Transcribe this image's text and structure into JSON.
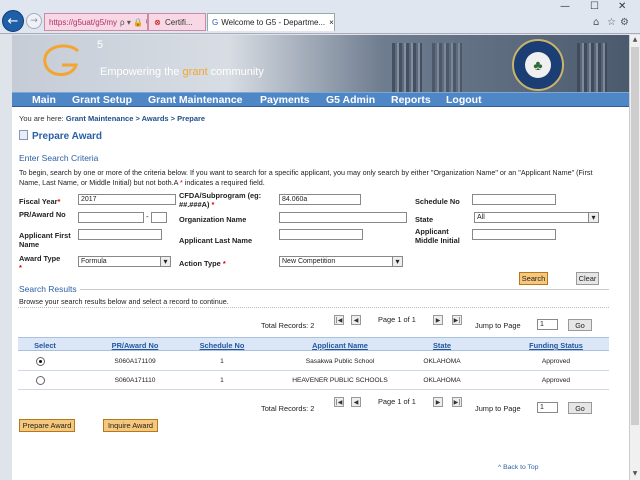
{
  "browser": {
    "address": "https://g5uat/g5/my",
    "address_icons": "ρ ▾ 🔒 ↻",
    "cert_tab": "Certifi...",
    "active_tab": "Welcome to G5 - Departme...",
    "tab_close": "×",
    "controls": {
      "minimize": "—",
      "maximize": "☐",
      "close": "✕"
    },
    "tools": {
      "home": "⌂",
      "favorites": "☆",
      "settings": "⚙"
    }
  },
  "banner": {
    "logo_text": "G",
    "logo_super": "5",
    "tagline_pre": "Empowering the ",
    "tagline_accent": "grant",
    "tagline_post": " community",
    "seal_icon": "tree-icon"
  },
  "menu": [
    "Main",
    "Grant Setup",
    "Grant Maintenance",
    "Payments",
    "G5 Admin",
    "Reports",
    "Logout"
  ],
  "breadcrumb": {
    "prefix": "You are here:",
    "path": "Grant Maintenance > Awards > Prepare"
  },
  "page_title": "Prepare Award",
  "search": {
    "heading": "Enter Search Criteria",
    "intro": "To begin, search by one or more of the criteria below. If you want to search for a specific applicant, you may only search by either \"Organization Name\" or an \"Applicant Name\" (First Name, Last Name, or Middle Initial) but not both.A ",
    "intro_star": "*",
    "intro_end": " indicates a required field.",
    "fiscal_year_label": "Fiscal Year",
    "fiscal_year_value": "2017",
    "cfda_label": "CFDA/Subprogram (eg: ##.###A)",
    "cfda_value": "84.060a",
    "schedule_label": "Schedule No",
    "schedule_value": "",
    "pr_award_label": "PR/Award No",
    "pr_award_value": "",
    "pr_award_suffix": "",
    "org_label": "Organization Name",
    "org_value": "",
    "state_label": "State",
    "state_value": "All",
    "first_name_label": "Applicant First Name",
    "first_name_value": "",
    "last_name_label": "Applicant Last Name",
    "last_name_value": "",
    "middle_label": "Applicant Middle Initial",
    "middle_value": "",
    "award_type_label": "Award Type",
    "award_type_value": "Formula",
    "action_type_label": "Action Type",
    "action_type_value": "New Competition",
    "required_star": "*",
    "search_button": "Search",
    "clear_button": "Clear"
  },
  "results": {
    "heading": "Search Results",
    "intro": "Browse your search results below and select a record to continue.",
    "total_records": "Total Records: 2",
    "page_info": "Page 1 of 1",
    "jump_label": "Jump to Page",
    "jump_value": "1",
    "go_button": "Go",
    "pager_icons": [
      "|◀",
      "◀",
      "▶",
      "▶|"
    ],
    "columns": [
      "Select",
      "PR/Award No",
      "Schedule No",
      "Applicant Name",
      "State",
      "Funding Status"
    ],
    "rows": [
      {
        "selected": true,
        "award": "S060A171109",
        "schedule": "1",
        "applicant": "Sasakwa Public School",
        "state": "OKLAHOMA",
        "status": "Approved"
      },
      {
        "selected": false,
        "award": "S060A171110",
        "schedule": "1",
        "applicant": "HEAVENER PUBLIC SCHOOLS",
        "state": "OKLAHOMA",
        "status": "Approved"
      }
    ]
  },
  "actions": {
    "prepare": "Prepare Award",
    "inquire": "Inquire Award"
  },
  "back_to_top": "^ Back to Top",
  "colors": {
    "menu_bar": "#4f86c6",
    "title_blue": "#2a5fa3",
    "button_orange": "#f7c77b",
    "accent_grant": "#f3a530"
  }
}
